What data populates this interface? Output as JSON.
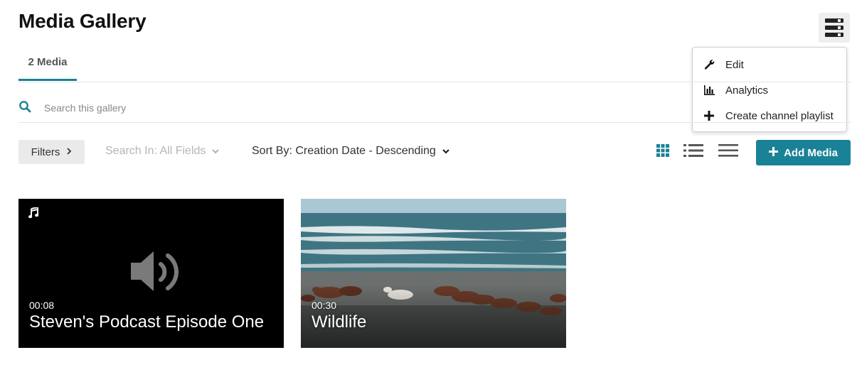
{
  "header": {
    "title": "Media Gallery"
  },
  "actions_menu": {
    "toggle_icon": "menu-toggle-icon",
    "items": [
      {
        "label": "Edit",
        "icon": "wrench-icon"
      },
      {
        "label": "Analytics",
        "icon": "bar-chart-icon"
      },
      {
        "label": "Create channel playlist",
        "icon": "plus-icon"
      }
    ]
  },
  "tabs": [
    {
      "label": "2 Media",
      "active": true
    }
  ],
  "search": {
    "placeholder": "Search this gallery",
    "value": ""
  },
  "toolbar": {
    "filters_label": "Filters",
    "search_in_label": "Search In: All Fields",
    "sort_by_label": "Sort By: Creation Date - Descending",
    "views": [
      {
        "name": "grid-view",
        "active": true
      },
      {
        "name": "detailed-list-view",
        "active": false
      },
      {
        "name": "compact-list-view",
        "active": false
      }
    ],
    "add_media_label": "Add Media"
  },
  "media": [
    {
      "duration": "00:08",
      "title": "Steven's Podcast Episode One",
      "type": "audio"
    },
    {
      "duration": "00:30",
      "title": "Wildlife",
      "type": "video"
    }
  ],
  "colors": {
    "accent": "#1a8296",
    "audio_thumb": "#000000"
  }
}
